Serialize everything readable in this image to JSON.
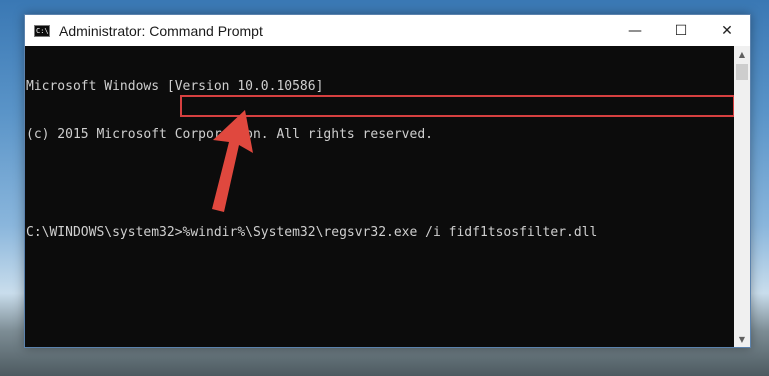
{
  "window": {
    "title": "Administrator: Command Prompt",
    "icon_text": "C:\\",
    "controls": {
      "minimize": "—",
      "maximize": "☐",
      "close": "✕"
    }
  },
  "console": {
    "lines": [
      "Microsoft Windows [Version 10.0.10586]",
      "(c) 2015 Microsoft Corporotion. All rights reserved.",
      "",
      "C:\\WINDOWS\\system32>%windir%\\System32\\regsvr32.exe /i fidf1tsosfilter.dll"
    ]
  },
  "scrollbar": {
    "up": "▲",
    "down": "▼"
  },
  "annotation": {
    "arrow_color": "#e0483e",
    "highlight_color": "#d64040"
  }
}
